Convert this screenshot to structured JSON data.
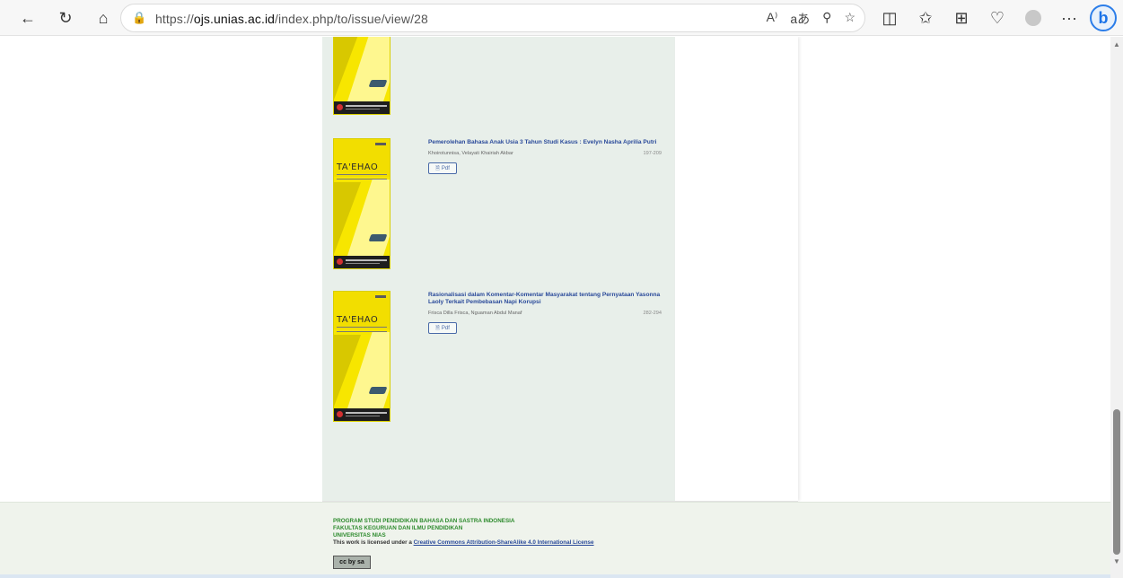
{
  "browser": {
    "url_prefix": "https://",
    "url_domain": "ojs.unias.ac.id",
    "url_path": "/index.php/to/issue/view/28",
    "nav_icons": [
      "back-icon",
      "refresh-icon",
      "home-icon"
    ],
    "lock_icon": "lock-icon",
    "url_icons": [
      "read-aloud-icon",
      "translate-icon",
      "zoom-icon",
      "favorite-icon"
    ],
    "toolbar_icons": [
      "split-screen-icon",
      "favorites-icon",
      "collections-icon",
      "browser-essentials-icon",
      "profile-icon",
      "more-icon",
      "bing-icon"
    ],
    "read_aloud_glyph": "A⁾",
    "translate_glyph": "aあ",
    "more_glyph": "···",
    "bing_glyph": "b"
  },
  "articles": [
    {
      "title": "Pemerolehan Bahasa Anak Usia 3 Tahun Studi Kasus : Evelyn Nasha Aprilia Putri",
      "authors": "Khoirotunnisa, Velayati Khairiah Akbar",
      "pages": "197-209",
      "galley_label": "Pdf",
      "cover_title": "TA'EHAO"
    },
    {
      "title": "Rasionalisasi dalam Komentar-Komentar Masyarakat tentang Pernyataan Yasonna Laoly Terkait Pembebasan Napi Korupsi",
      "authors": "Frisca Dilla Frisca, Nguaman Abdul Manaf",
      "pages": "282-294",
      "galley_label": "Pdf",
      "cover_title": "TA'EHAO"
    }
  ],
  "footer": {
    "line1": "PROGRAM STUDI PENDIDIKAN BAHASA DAN SASTRA INDONESIA",
    "line2": "FAKULTAS KEGURUAN DAN ILMU PENDIDIKAN",
    "line3": "UNIVERSITAS NIAS",
    "license_prefix": "This work is licensed under a ",
    "license_link": "Creative Commons Attribution-ShareAlike 4.0 International License",
    "cc_badge": "cc by sa"
  },
  "colors": {
    "accent": "#2a4a9a",
    "footer_green": "#2c8a2c",
    "cover_yellow": "#f7e600",
    "content_bg": "#e8efea"
  }
}
